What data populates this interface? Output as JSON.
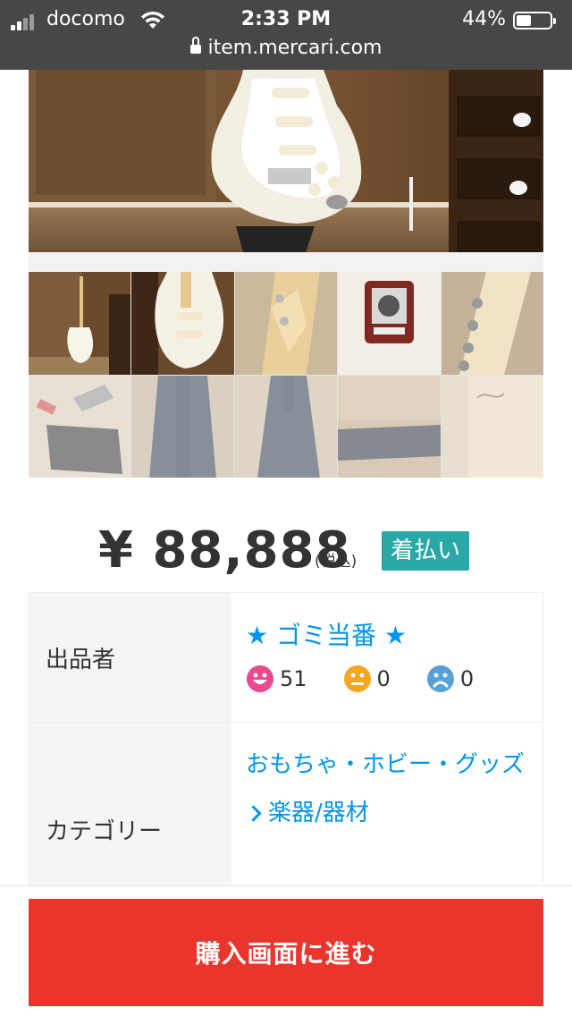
{
  "status_bar": {
    "carrier": "docomo",
    "time": "2:33 PM",
    "battery_percent": "44%",
    "battery_level": 0.44
  },
  "url_bar": {
    "url": "item.mercari.com"
  },
  "gallery": {
    "main_photo_alt": "guitar-photo",
    "thumbnail_count": 10
  },
  "price": {
    "amount": "¥ 88,888",
    "tax_label": "(税込)",
    "shipping_badge": "着払い"
  },
  "seller": {
    "label": "出品者",
    "name": "★ ゴミ当番 ★",
    "ratings": [
      {
        "icon": "smile-face-icon",
        "count": "51",
        "color": "#e84a8d"
      },
      {
        "icon": "neutral-face-icon",
        "count": "0",
        "color": "#f5a623"
      },
      {
        "icon": "sad-face-icon",
        "count": "0",
        "color": "#5aa0d8"
      }
    ]
  },
  "category": {
    "label": "カテゴリー",
    "main": "おもちゃ・ホビー・グッズ",
    "sub": "楽器/器材"
  },
  "buy_button": {
    "label": "購入画面に進む",
    "color": "#ea352d"
  }
}
